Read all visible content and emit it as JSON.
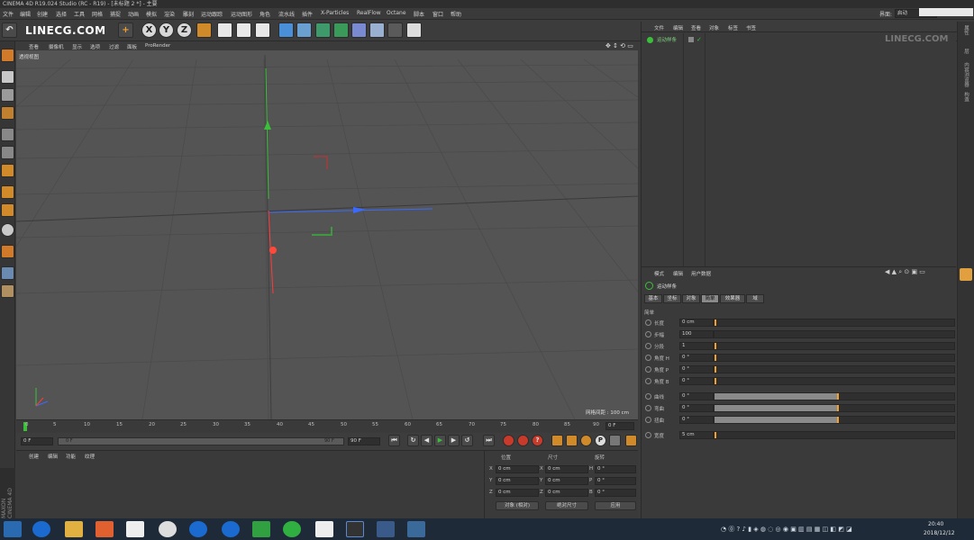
{
  "window": {
    "title": "CINEMA 4D R19.024 Studio (RC - R19) - [未标题 2 *] - 主要"
  },
  "menu": [
    "文件",
    "编辑",
    "创建",
    "选择",
    "工具",
    "网格",
    "捕捉",
    "动画",
    "模拟",
    "渲染",
    "雕刻",
    "运动跟踪",
    "运动图形",
    "角色",
    "流水线",
    "插件",
    "X-Particles",
    "RealFlow",
    "Octane",
    "脚本",
    "窗口",
    "帮助"
  ],
  "layout": {
    "label": "界面:",
    "value": "启动"
  },
  "watermark": "LINECG.COM",
  "watermark2": "LINECG.COM",
  "viewport": {
    "menu": [
      "查看",
      "摄像机",
      "显示",
      "选项",
      "过滤",
      "面板",
      "ProRender"
    ],
    "name": "透视视图",
    "grid_label": "网格间距 : 100 cm"
  },
  "timeline": {
    "ticks": [
      "0",
      "5",
      "10",
      "15",
      "20",
      "25",
      "30",
      "35",
      "40",
      "45",
      "50",
      "55",
      "60",
      "65",
      "70",
      "75",
      "80",
      "85",
      "90"
    ],
    "end_field": "0 F"
  },
  "playbar": {
    "current": "0 F",
    "start": "0 F",
    "range_end": "90 F",
    "end": "90 F"
  },
  "materials": {
    "menu": [
      "创建",
      "编辑",
      "功能",
      "纹理"
    ]
  },
  "coords": {
    "headers": [
      "位置",
      "尺寸",
      "旋转"
    ],
    "rows": [
      {
        "axis": "X",
        "pos": "0 cm",
        "size_axis": "X",
        "size": "0 cm",
        "rot_axis": "H",
        "rot": "0 °"
      },
      {
        "axis": "Y",
        "pos": "0 cm",
        "size_axis": "Y",
        "size": "0 cm",
        "rot_axis": "P",
        "rot": "0 °"
      },
      {
        "axis": "Z",
        "pos": "0 cm",
        "size_axis": "Z",
        "size": "0 cm",
        "rot_axis": "B",
        "rot": "0 °"
      }
    ],
    "mode": "对象 (相对)",
    "size_mode": "绝对尺寸",
    "apply": "应用"
  },
  "objects": {
    "menu": [
      "文件",
      "编辑",
      "查看",
      "对象",
      "标签",
      "书签"
    ],
    "item": "运动样条"
  },
  "attributes": {
    "menu": [
      "模式",
      "编辑",
      "用户数据"
    ],
    "object_name": "运动样条",
    "tabs": [
      "基本",
      "坐标",
      "对象",
      "简单",
      "效果器",
      "域"
    ],
    "active_tab": "简单",
    "section": "简单",
    "fields": [
      {
        "label": "长度",
        "value": "0 cm"
      },
      {
        "label": "步幅",
        "value": "100"
      },
      {
        "label": "分段",
        "value": "1"
      },
      {
        "label": "角度 H",
        "value": "0 °"
      },
      {
        "label": "角度 P",
        "value": "0 °"
      },
      {
        "label": "角度 B",
        "value": "0 °"
      }
    ],
    "curves": [
      {
        "label": "曲线",
        "value": "0 °"
      },
      {
        "label": "弯曲",
        "value": "0 °"
      },
      {
        "label": "扭曲",
        "value": "0 °"
      }
    ],
    "width": {
      "label": "宽度",
      "value": "5 cm"
    }
  },
  "sidebar_right": [
    "属性",
    "层",
    "内容浏览器",
    "构造"
  ],
  "brand_side": {
    "maxon": "MAXON",
    "cinema": "CINEMA 4D"
  },
  "clock": {
    "time": "20:40",
    "date": "2018/12/12"
  }
}
